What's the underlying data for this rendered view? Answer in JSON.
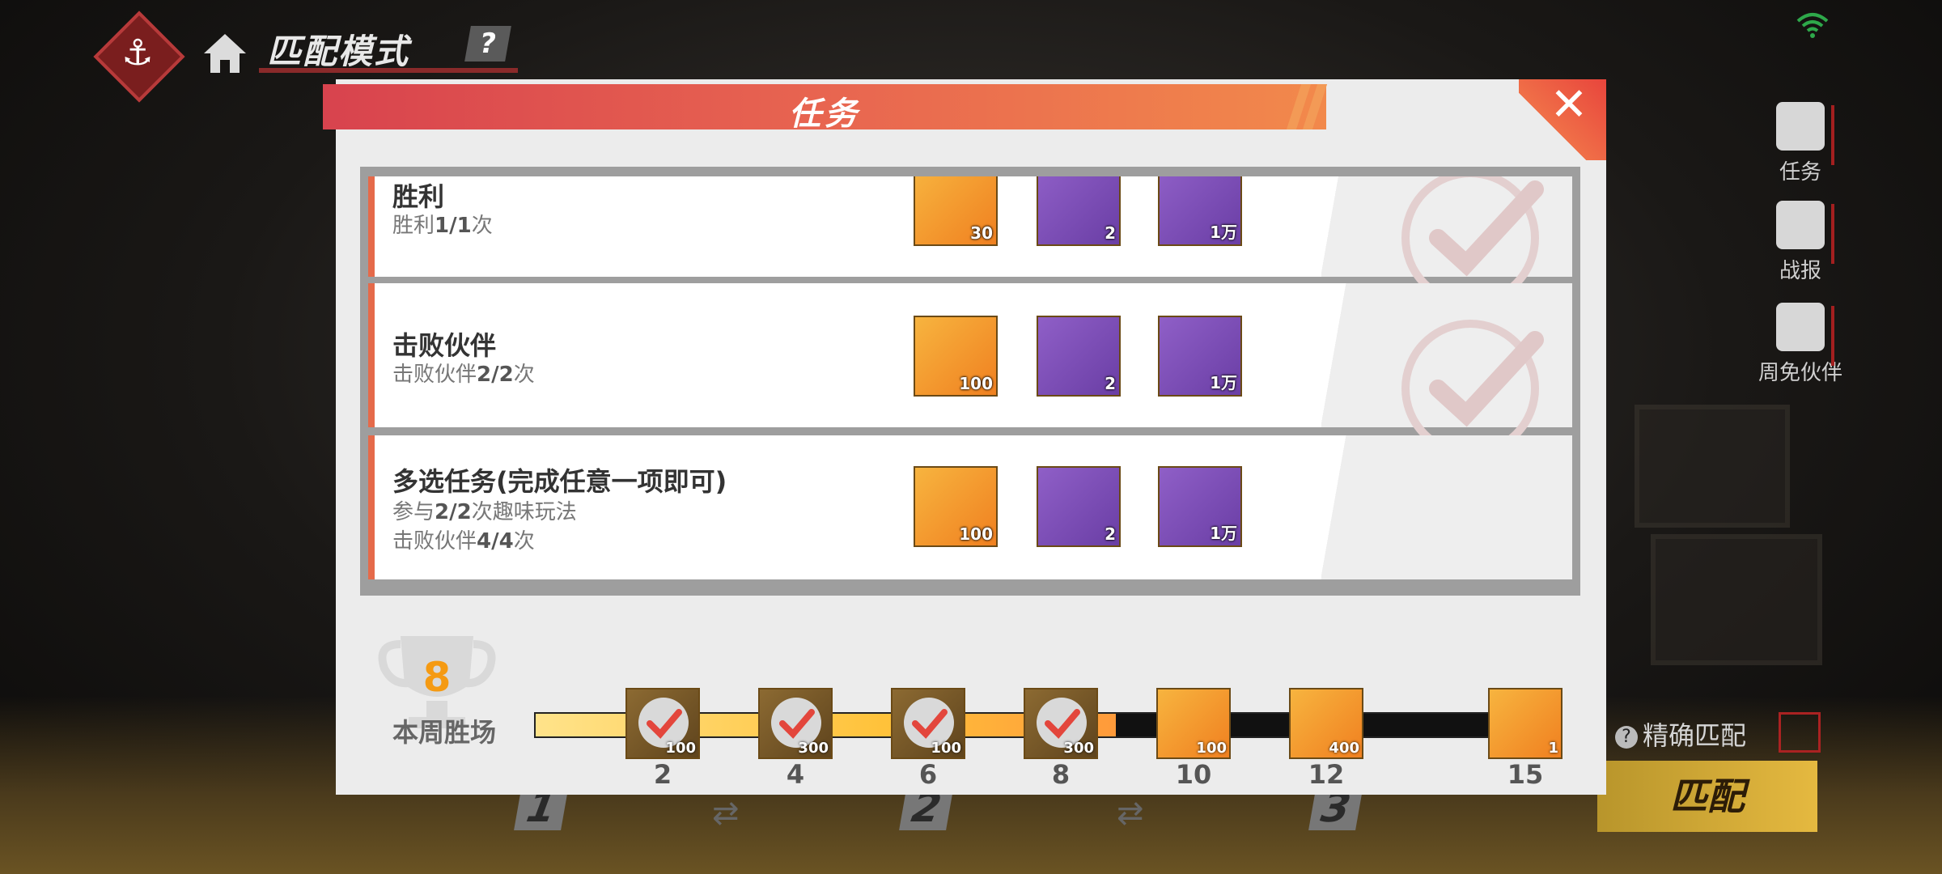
{
  "header": {
    "mode_title": "匹配模式",
    "help_icon": "?"
  },
  "side_menu": [
    {
      "icon": "task-scroll-icon",
      "label": "任务"
    },
    {
      "icon": "megaphone-icon",
      "label": "战报"
    },
    {
      "icon": "help-book-icon",
      "label": "周免伙伴"
    }
  ],
  "precise_match": {
    "label": "精确匹配",
    "checked": false
  },
  "match_button": "匹配",
  "stages": [
    "1",
    "2",
    "3"
  ],
  "modal": {
    "title": "任务",
    "tasks": [
      {
        "name": "胜利",
        "progress_prefix": "胜利",
        "progress": "1/1",
        "progress_suffix": "次",
        "completed": true,
        "rewards": [
          {
            "icon": "devil-fruit-icon",
            "qty": "30",
            "style": "orange"
          },
          {
            "icon": "exp-book-icon",
            "qty": "2",
            "style": "purple"
          },
          {
            "icon": "berry-coin-icon",
            "qty": "1万",
            "style": "purple"
          }
        ]
      },
      {
        "name": "击败伙伴",
        "progress_prefix": "击败伙伴",
        "progress": "2/2",
        "progress_suffix": "次",
        "completed": true,
        "rewards": [
          {
            "icon": "silver-anchor-icon",
            "qty": "100",
            "style": "orange"
          },
          {
            "icon": "exp-book-icon",
            "qty": "2",
            "style": "purple"
          },
          {
            "icon": "berry-coin-icon",
            "qty": "1万",
            "style": "purple"
          }
        ]
      },
      {
        "name": "多选任务(完成任意一项即可)",
        "line1_prefix": "参与",
        "line1_progress": "2/2",
        "line1_suffix": "次趣味玩法",
        "line2_prefix": "击败伙伴",
        "line2_progress": "4/4",
        "line2_suffix": "次",
        "completed": false,
        "rewards": [
          {
            "icon": "silver-anchor-icon",
            "qty": "100",
            "style": "orange"
          },
          {
            "icon": "exp-book-icon",
            "qty": "2",
            "style": "purple"
          },
          {
            "icon": "berry-coin-icon",
            "qty": "1万",
            "style": "purple"
          }
        ]
      }
    ],
    "weekly": {
      "wins": "8",
      "label": "本周胜场",
      "progress_fraction": 0.6,
      "milestones": [
        {
          "wins": "2",
          "qty": "100",
          "claimed": true,
          "icon": "devil-fruit-icon"
        },
        {
          "wins": "4",
          "qty": "300",
          "claimed": true,
          "icon": "silver-anchor-icon"
        },
        {
          "wins": "6",
          "qty": "100",
          "claimed": true,
          "icon": "devil-fruit-icon"
        },
        {
          "wins": "8",
          "qty": "300",
          "claimed": true,
          "icon": "silver-anchor-icon"
        },
        {
          "wins": "10",
          "qty": "100",
          "claimed": false,
          "icon": "devil-fruit-icon"
        },
        {
          "wins": "12",
          "qty": "400",
          "claimed": false,
          "icon": "silver-anchor-icon"
        },
        {
          "wins": "15",
          "qty": "1",
          "claimed": false,
          "icon": "ticket-icon"
        }
      ]
    }
  },
  "colors": {
    "accent_red": "#d8434e",
    "accent_orange": "#f2894b",
    "win_count": "#f59a12",
    "reward_purple": "#7a4cb6",
    "reward_orange": "#f5a83a"
  }
}
